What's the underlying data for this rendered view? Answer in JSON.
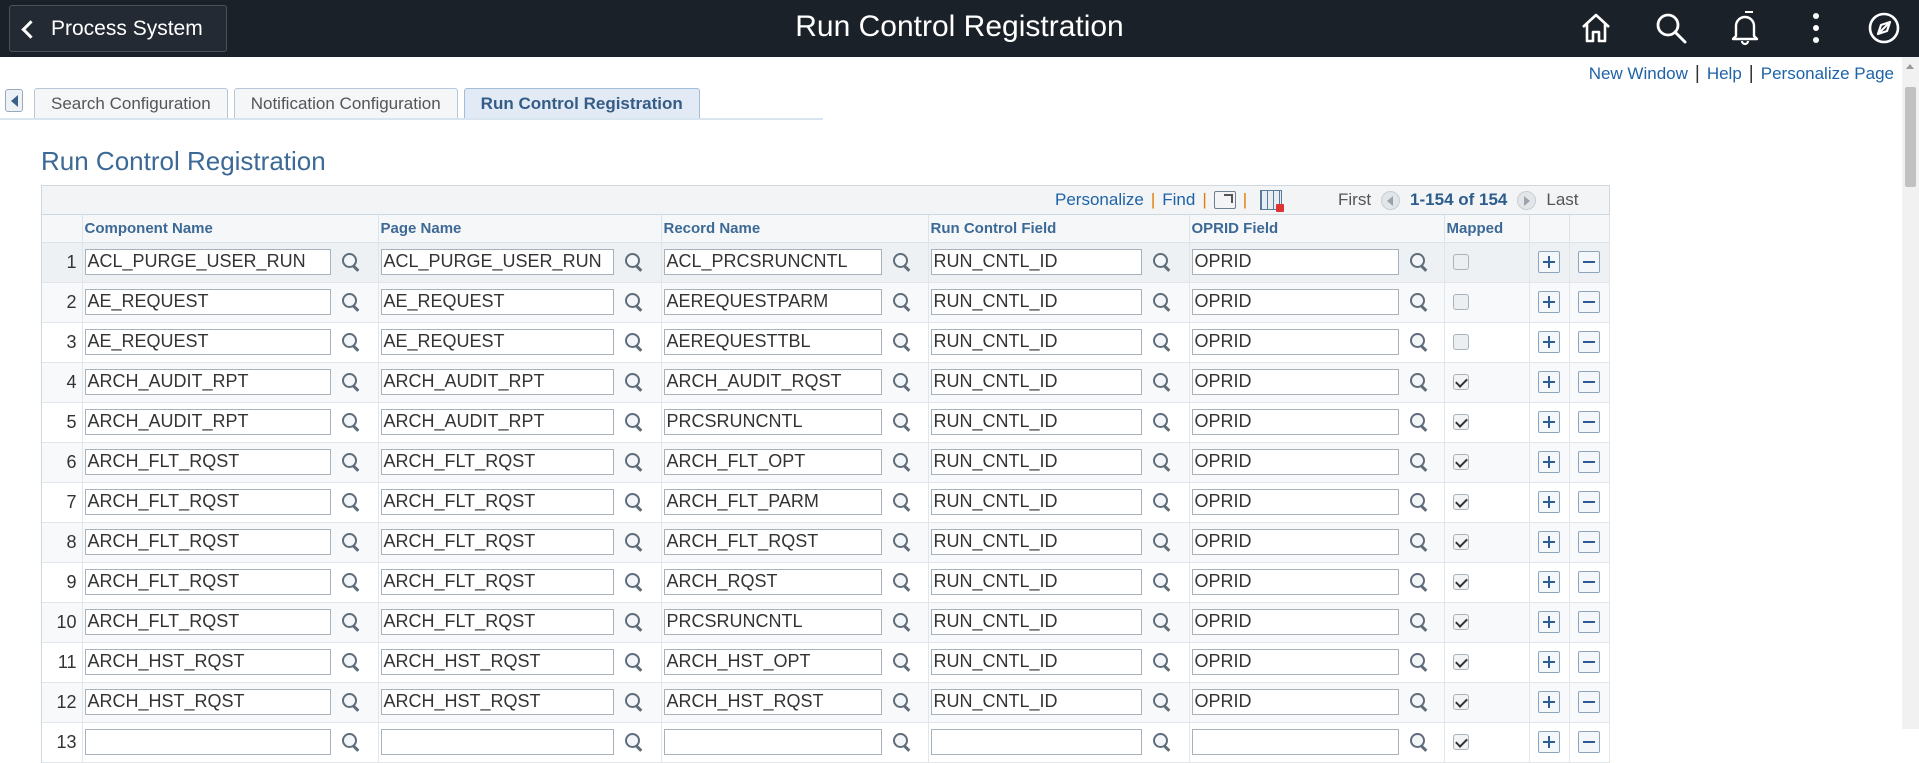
{
  "header": {
    "back_label": "Process System",
    "title": "Run Control Registration",
    "icons": [
      "home-icon",
      "search-icon",
      "notifications-icon",
      "actions-menu-icon",
      "navbar-compass-icon"
    ]
  },
  "links": {
    "new_window": "New Window",
    "help": "Help",
    "personalize_page": "Personalize Page"
  },
  "tabs": [
    {
      "label": "Search Configuration",
      "active": false
    },
    {
      "label": "Notification Configuration",
      "active": false
    },
    {
      "label": "Run Control Registration",
      "active": true
    }
  ],
  "page": {
    "title": "Run Control Registration"
  },
  "grid": {
    "personalize": "Personalize",
    "find": "Find",
    "first": "First",
    "range": "1-154 of 154",
    "last": "Last",
    "columns": {
      "component": "Component Name",
      "page": "Page Name",
      "record": "Record Name",
      "runcntl": "Run Control Field",
      "oprid": "OPRID Field",
      "mapped": "Mapped"
    },
    "rows": [
      {
        "num": "1",
        "component": "ACL_PURGE_USER_RUN",
        "page": "ACL_PURGE_USER_RUN",
        "record": "ACL_PRCSRUNCNTL",
        "runcntl": "RUN_CNTL_ID",
        "oprid": "OPRID",
        "mapped": false
      },
      {
        "num": "2",
        "component": "AE_REQUEST",
        "page": "AE_REQUEST",
        "record": "AEREQUESTPARM",
        "runcntl": "RUN_CNTL_ID",
        "oprid": "OPRID",
        "mapped": false
      },
      {
        "num": "3",
        "component": "AE_REQUEST",
        "page": "AE_REQUEST",
        "record": "AEREQUESTTBL",
        "runcntl": "RUN_CNTL_ID",
        "oprid": "OPRID",
        "mapped": false
      },
      {
        "num": "4",
        "component": "ARCH_AUDIT_RPT",
        "page": "ARCH_AUDIT_RPT",
        "record": "ARCH_AUDIT_RQST",
        "runcntl": "RUN_CNTL_ID",
        "oprid": "OPRID",
        "mapped": true
      },
      {
        "num": "5",
        "component": "ARCH_AUDIT_RPT",
        "page": "ARCH_AUDIT_RPT",
        "record": "PRCSRUNCNTL",
        "runcntl": "RUN_CNTL_ID",
        "oprid": "OPRID",
        "mapped": true
      },
      {
        "num": "6",
        "component": "ARCH_FLT_RQST",
        "page": "ARCH_FLT_RQST",
        "record": "ARCH_FLT_OPT",
        "runcntl": "RUN_CNTL_ID",
        "oprid": "OPRID",
        "mapped": true
      },
      {
        "num": "7",
        "component": "ARCH_FLT_RQST",
        "page": "ARCH_FLT_RQST",
        "record": "ARCH_FLT_PARM",
        "runcntl": "RUN_CNTL_ID",
        "oprid": "OPRID",
        "mapped": true
      },
      {
        "num": "8",
        "component": "ARCH_FLT_RQST",
        "page": "ARCH_FLT_RQST",
        "record": "ARCH_FLT_RQST",
        "runcntl": "RUN_CNTL_ID",
        "oprid": "OPRID",
        "mapped": true
      },
      {
        "num": "9",
        "component": "ARCH_FLT_RQST",
        "page": "ARCH_FLT_RQST",
        "record": "ARCH_RQST",
        "runcntl": "RUN_CNTL_ID",
        "oprid": "OPRID",
        "mapped": true
      },
      {
        "num": "10",
        "component": "ARCH_FLT_RQST",
        "page": "ARCH_FLT_RQST",
        "record": "PRCSRUNCNTL",
        "runcntl": "RUN_CNTL_ID",
        "oprid": "OPRID",
        "mapped": true
      },
      {
        "num": "11",
        "component": "ARCH_HST_RQST",
        "page": "ARCH_HST_RQST",
        "record": "ARCH_HST_OPT",
        "runcntl": "RUN_CNTL_ID",
        "oprid": "OPRID",
        "mapped": true
      },
      {
        "num": "12",
        "component": "ARCH_HST_RQST",
        "page": "ARCH_HST_RQST",
        "record": "ARCH_HST_RQST",
        "runcntl": "RUN_CNTL_ID",
        "oprid": "OPRID",
        "mapped": true
      },
      {
        "num": "13",
        "component": "",
        "page": "",
        "record": "",
        "runcntl": "",
        "oprid": "",
        "mapped": true
      }
    ]
  },
  "colors": {
    "header_bg": "#1b2129",
    "link": "#1e63a8",
    "title": "#3c6996"
  }
}
